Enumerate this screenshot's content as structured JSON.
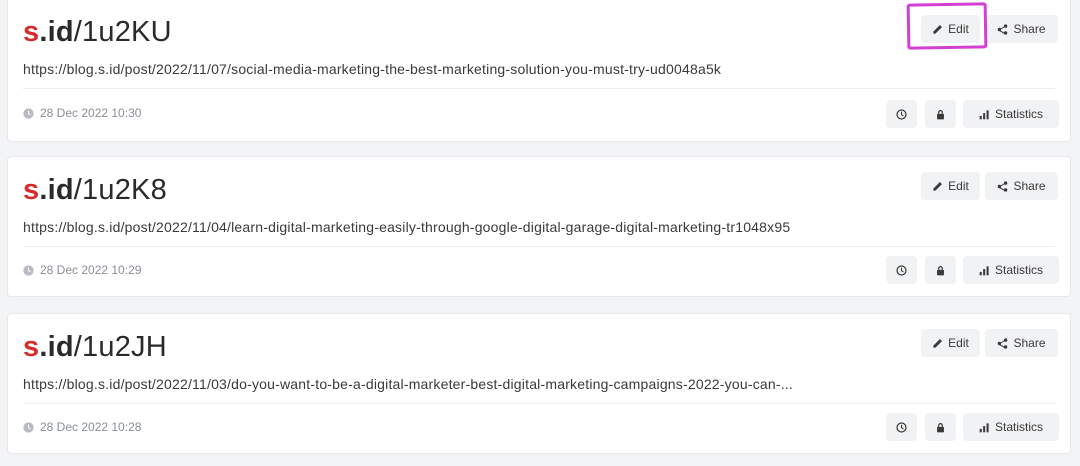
{
  "links": [
    {
      "brand_s": "s",
      "brand_id": ".id",
      "slash": "/",
      "code": "1u2KU",
      "url": "https://blog.s.id/post/2022/11/07/social-media-marketing-the-best-marketing-solution-you-must-try-ud0048a5k",
      "date": "28 Dec 2022 10:30",
      "edit_label": "Edit",
      "share_label": "Share",
      "stats_label": "Statistics"
    },
    {
      "brand_s": "s",
      "brand_id": ".id",
      "slash": "/",
      "code": "1u2K8",
      "url": "https://blog.s.id/post/2022/11/04/learn-digital-marketing-easily-through-google-digital-garage-digital-marketing-tr1048x95",
      "date": "28 Dec 2022 10:29",
      "edit_label": "Edit",
      "share_label": "Share",
      "stats_label": "Statistics"
    },
    {
      "brand_s": "s",
      "brand_id": ".id",
      "slash": "/",
      "code": "1u2JH",
      "url": "https://blog.s.id/post/2022/11/03/do-you-want-to-be-a-digital-marketer-best-digital-marketing-campaigns-2022-you-can-...",
      "date": "28 Dec 2022 10:28",
      "edit_label": "Edit",
      "share_label": "Share",
      "stats_label": "Statistics"
    }
  ],
  "icons": {
    "edit": "pencil-icon",
    "share": "share-icon",
    "history": "clock-icon",
    "lock": "lock-icon",
    "stats": "bar-chart-icon",
    "date": "clock-icon"
  },
  "colors": {
    "brand_red": "#d62b2b",
    "highlight": "#d33fd1",
    "button_bg": "#f1f2f4",
    "page_bg": "#f3f4f6"
  }
}
